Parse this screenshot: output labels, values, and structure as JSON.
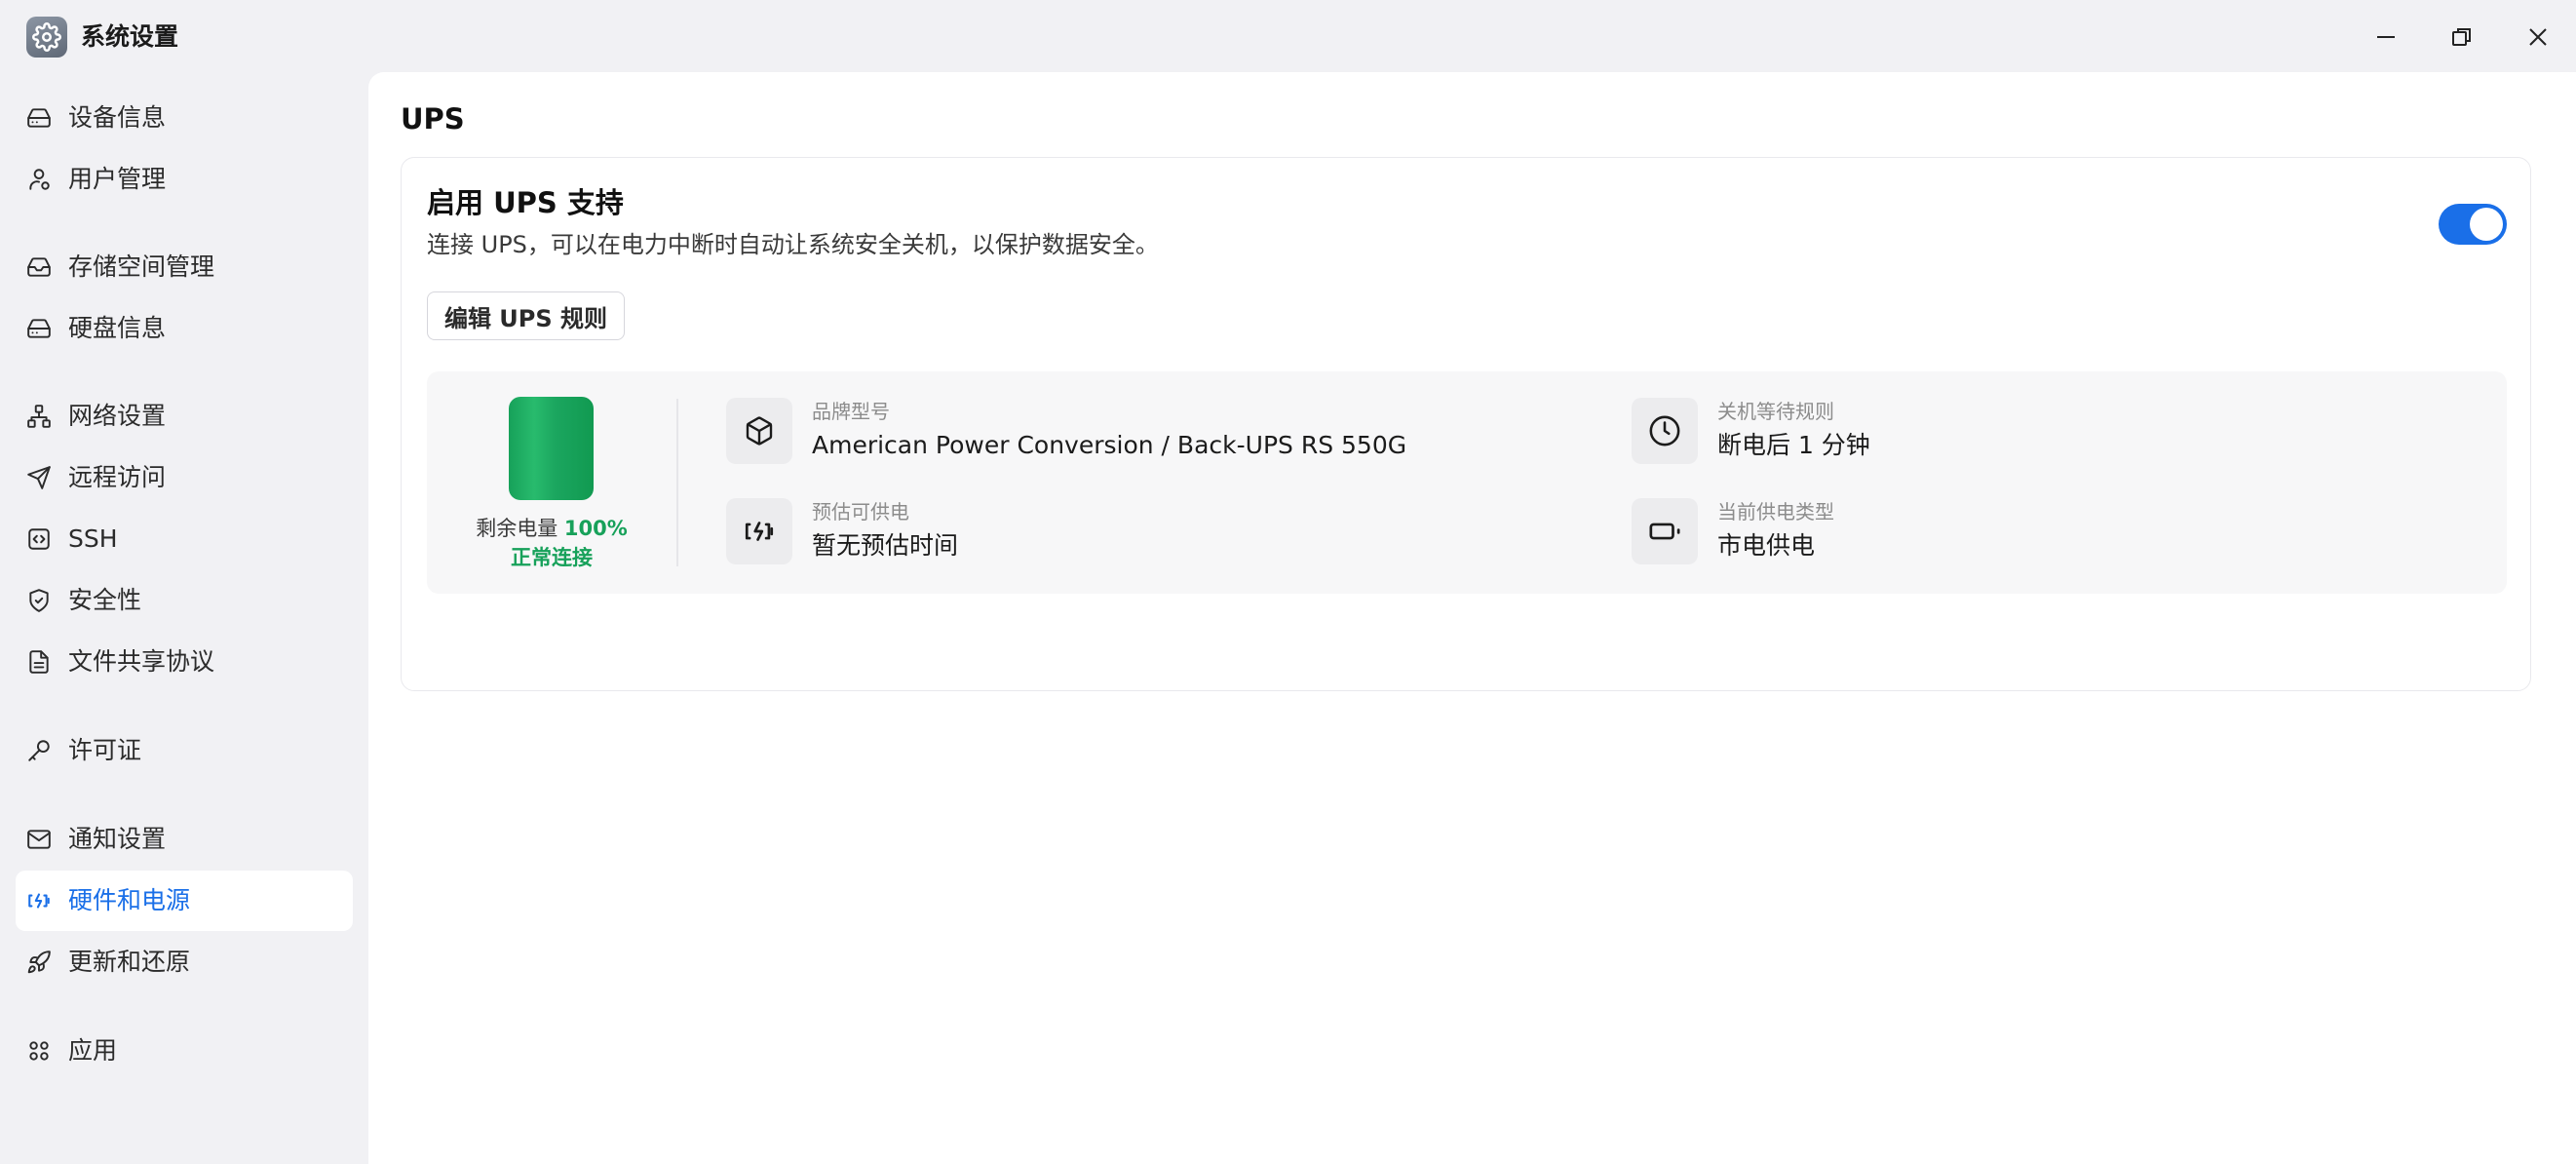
{
  "window": {
    "title": "系统设置",
    "icons": {
      "logo": "gear-icon",
      "minimize": "minimize-icon",
      "maximize": "restore-icon",
      "close": "close-icon"
    }
  },
  "sidebar": {
    "items": [
      {
        "label": "设备信息",
        "icon": "drive-icon",
        "active": false
      },
      {
        "label": "用户管理",
        "icon": "user-icon",
        "active": false
      },
      {
        "label": "存储空间管理",
        "icon": "inbox-icon",
        "active": false
      },
      {
        "label": "硬盘信息",
        "icon": "drive-icon",
        "active": false
      },
      {
        "label": "网络设置",
        "icon": "network-icon",
        "active": false
      },
      {
        "label": "远程访问",
        "icon": "send-icon",
        "active": false
      },
      {
        "label": "SSH",
        "icon": "code-icon",
        "active": false
      },
      {
        "label": "安全性",
        "icon": "shield-icon",
        "active": false
      },
      {
        "label": "文件共享协议",
        "icon": "document-icon",
        "active": false
      },
      {
        "label": "许可证",
        "icon": "key-icon",
        "active": false
      },
      {
        "label": "通知设置",
        "icon": "mail-icon",
        "active": false
      },
      {
        "label": "硬件和电源",
        "icon": "battery-charging-icon",
        "active": true
      },
      {
        "label": "更新和还原",
        "icon": "rocket-icon",
        "active": false
      },
      {
        "label": "应用",
        "icon": "apps-icon",
        "active": false
      }
    ]
  },
  "main": {
    "title": "UPS",
    "ups": {
      "heading": "启用 UPS 支持",
      "description": "连接 UPS，可以在电力中断时自动让系统安全关机，以保护数据安全。",
      "enabled": true,
      "edit_rules_label": "编辑 UPS 规则",
      "battery": {
        "label": "剩余电量",
        "percent": "100%",
        "level": 1.0,
        "color": "#17a15a",
        "connection": "正常连接"
      },
      "info": {
        "model": {
          "label": "品牌型号",
          "value": "American Power Conversion / Back-UPS RS 550G",
          "icon": "box-icon"
        },
        "shutdown_rule": {
          "label": "关机等待规则",
          "value": "断电后 1 分钟",
          "icon": "clock-icon"
        },
        "runtime": {
          "label": "预估可供电",
          "value": "暂无预估时间",
          "icon": "battery-charging-icon"
        },
        "power_source": {
          "label": "当前供电类型",
          "value": "市电供电",
          "icon": "battery-icon"
        }
      }
    }
  },
  "colors": {
    "accent": "#1a6fe8",
    "success": "#17a15a",
    "background": "#f1f1f4"
  }
}
